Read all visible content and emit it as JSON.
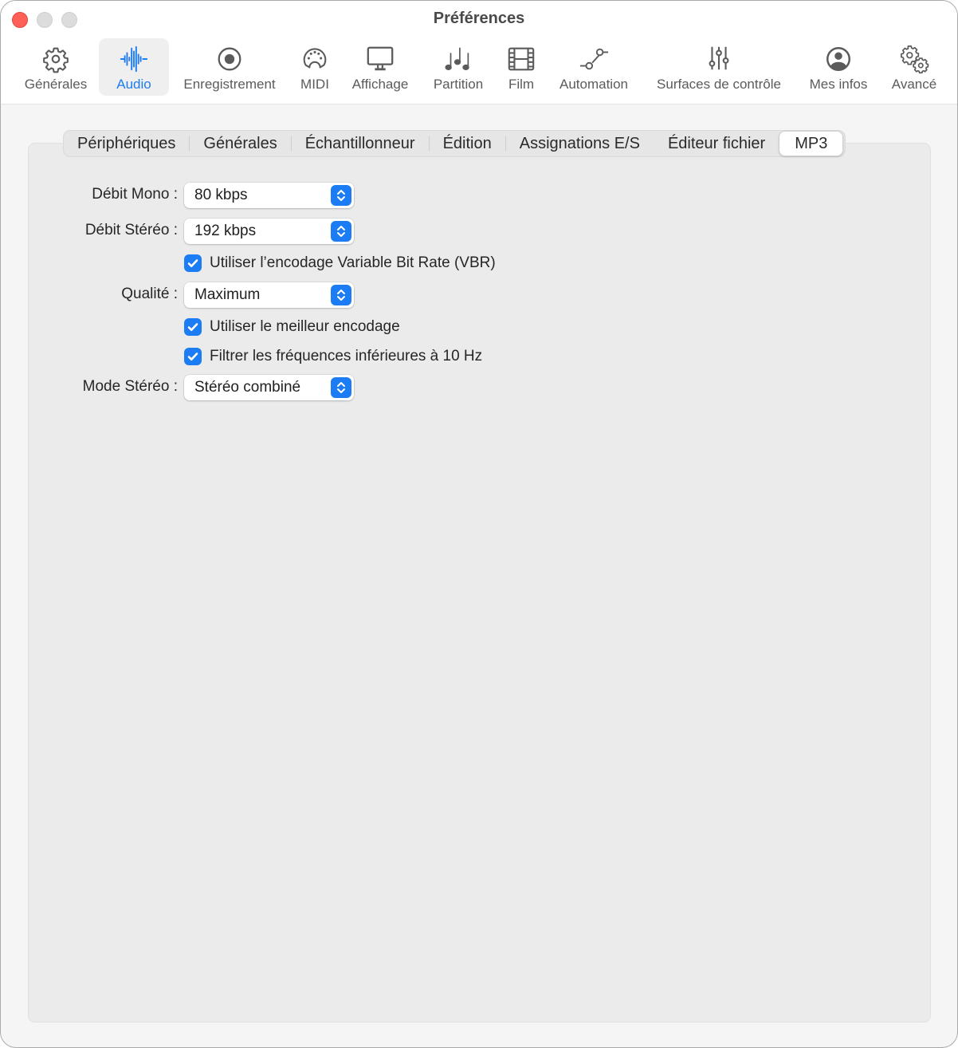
{
  "window": {
    "title": "Préférences"
  },
  "toolbar": {
    "items": [
      {
        "label": "Générales",
        "icon": "gear-icon",
        "active": false
      },
      {
        "label": "Audio",
        "icon": "waveform-icon",
        "active": true
      },
      {
        "label": "Enregistrement",
        "icon": "record-icon",
        "active": false
      },
      {
        "label": "MIDI",
        "icon": "midi-connector-icon",
        "active": false
      },
      {
        "label": "Affichage",
        "icon": "display-icon",
        "active": false
      },
      {
        "label": "Partition",
        "icon": "music-notes-icon",
        "active": false
      },
      {
        "label": "Film",
        "icon": "film-icon",
        "active": false
      },
      {
        "label": "Automation",
        "icon": "automation-curve-icon",
        "active": false
      },
      {
        "label": "Surfaces de contrôle",
        "icon": "sliders-icon",
        "active": false
      },
      {
        "label": "Mes infos",
        "icon": "person-circle-icon",
        "active": false
      },
      {
        "label": "Avancé",
        "icon": "gears-icon",
        "active": false
      }
    ]
  },
  "tabs": {
    "items": [
      {
        "label": "Périphériques",
        "active": false
      },
      {
        "label": "Générales",
        "active": false
      },
      {
        "label": "Échantillonneur",
        "active": false
      },
      {
        "label": "Édition",
        "active": false
      },
      {
        "label": "Assignations E/S",
        "active": false
      },
      {
        "label": "Éditeur fichier",
        "active": false
      },
      {
        "label": "MP3",
        "active": true
      }
    ]
  },
  "mp3": {
    "mono_bitrate": {
      "label": "Débit Mono :",
      "value": "80 kbps"
    },
    "stereo_bitrate": {
      "label": "Débit Stéréo :",
      "value": "192 kbps"
    },
    "vbr": {
      "label": "Utiliser l’encodage Variable Bit Rate (VBR)",
      "checked": true
    },
    "quality": {
      "label": "Qualité :",
      "value": "Maximum"
    },
    "best_encoding": {
      "label": "Utiliser le meilleur encodage",
      "checked": true
    },
    "filter_low": {
      "label": "Filtrer les fréquences inférieures à 10 Hz",
      "checked": true
    },
    "stereo_mode": {
      "label": "Mode Stéréo :",
      "value": "Stéréo combiné"
    }
  },
  "colors": {
    "accent": "#1c7cf4",
    "close": "#fe5f57"
  }
}
